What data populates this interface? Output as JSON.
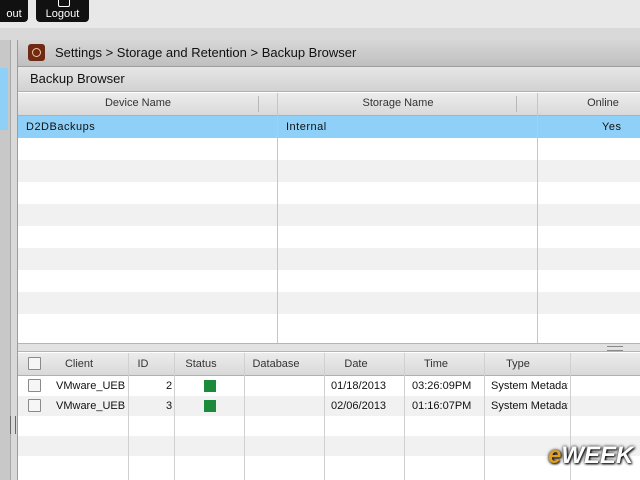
{
  "top_buttons": [
    {
      "label": "out"
    },
    {
      "label": "Logout"
    }
  ],
  "breadcrumb": "Settings > Storage and Retention > Backup Browser",
  "subtitle": "Backup Browser",
  "device_grid": {
    "columns": [
      "Device Name",
      "Storage Name",
      "Online"
    ],
    "rows": [
      {
        "device": "D2DBackups",
        "storage": "Internal",
        "online": "Yes"
      }
    ]
  },
  "backup_grid": {
    "columns": [
      "Client",
      "ID",
      "Status",
      "Database",
      "Date",
      "Time",
      "Type"
    ],
    "rows": [
      {
        "client": "VMware_UEB",
        "id": "2",
        "status": "ok",
        "database": "",
        "date": "01/18/2013",
        "time": "03:26:09PM",
        "type": "System Metadata"
      },
      {
        "client": "VMware_UEB",
        "id": "3",
        "status": "ok",
        "database": "",
        "date": "02/06/2013",
        "time": "01:16:07PM",
        "type": "System Metadata"
      }
    ]
  },
  "colors": {
    "selected_row": "#8fd0f8",
    "status_ok": "#1b8a3b"
  },
  "watermark": {
    "prefix": "e",
    "rest": "WEEK"
  }
}
